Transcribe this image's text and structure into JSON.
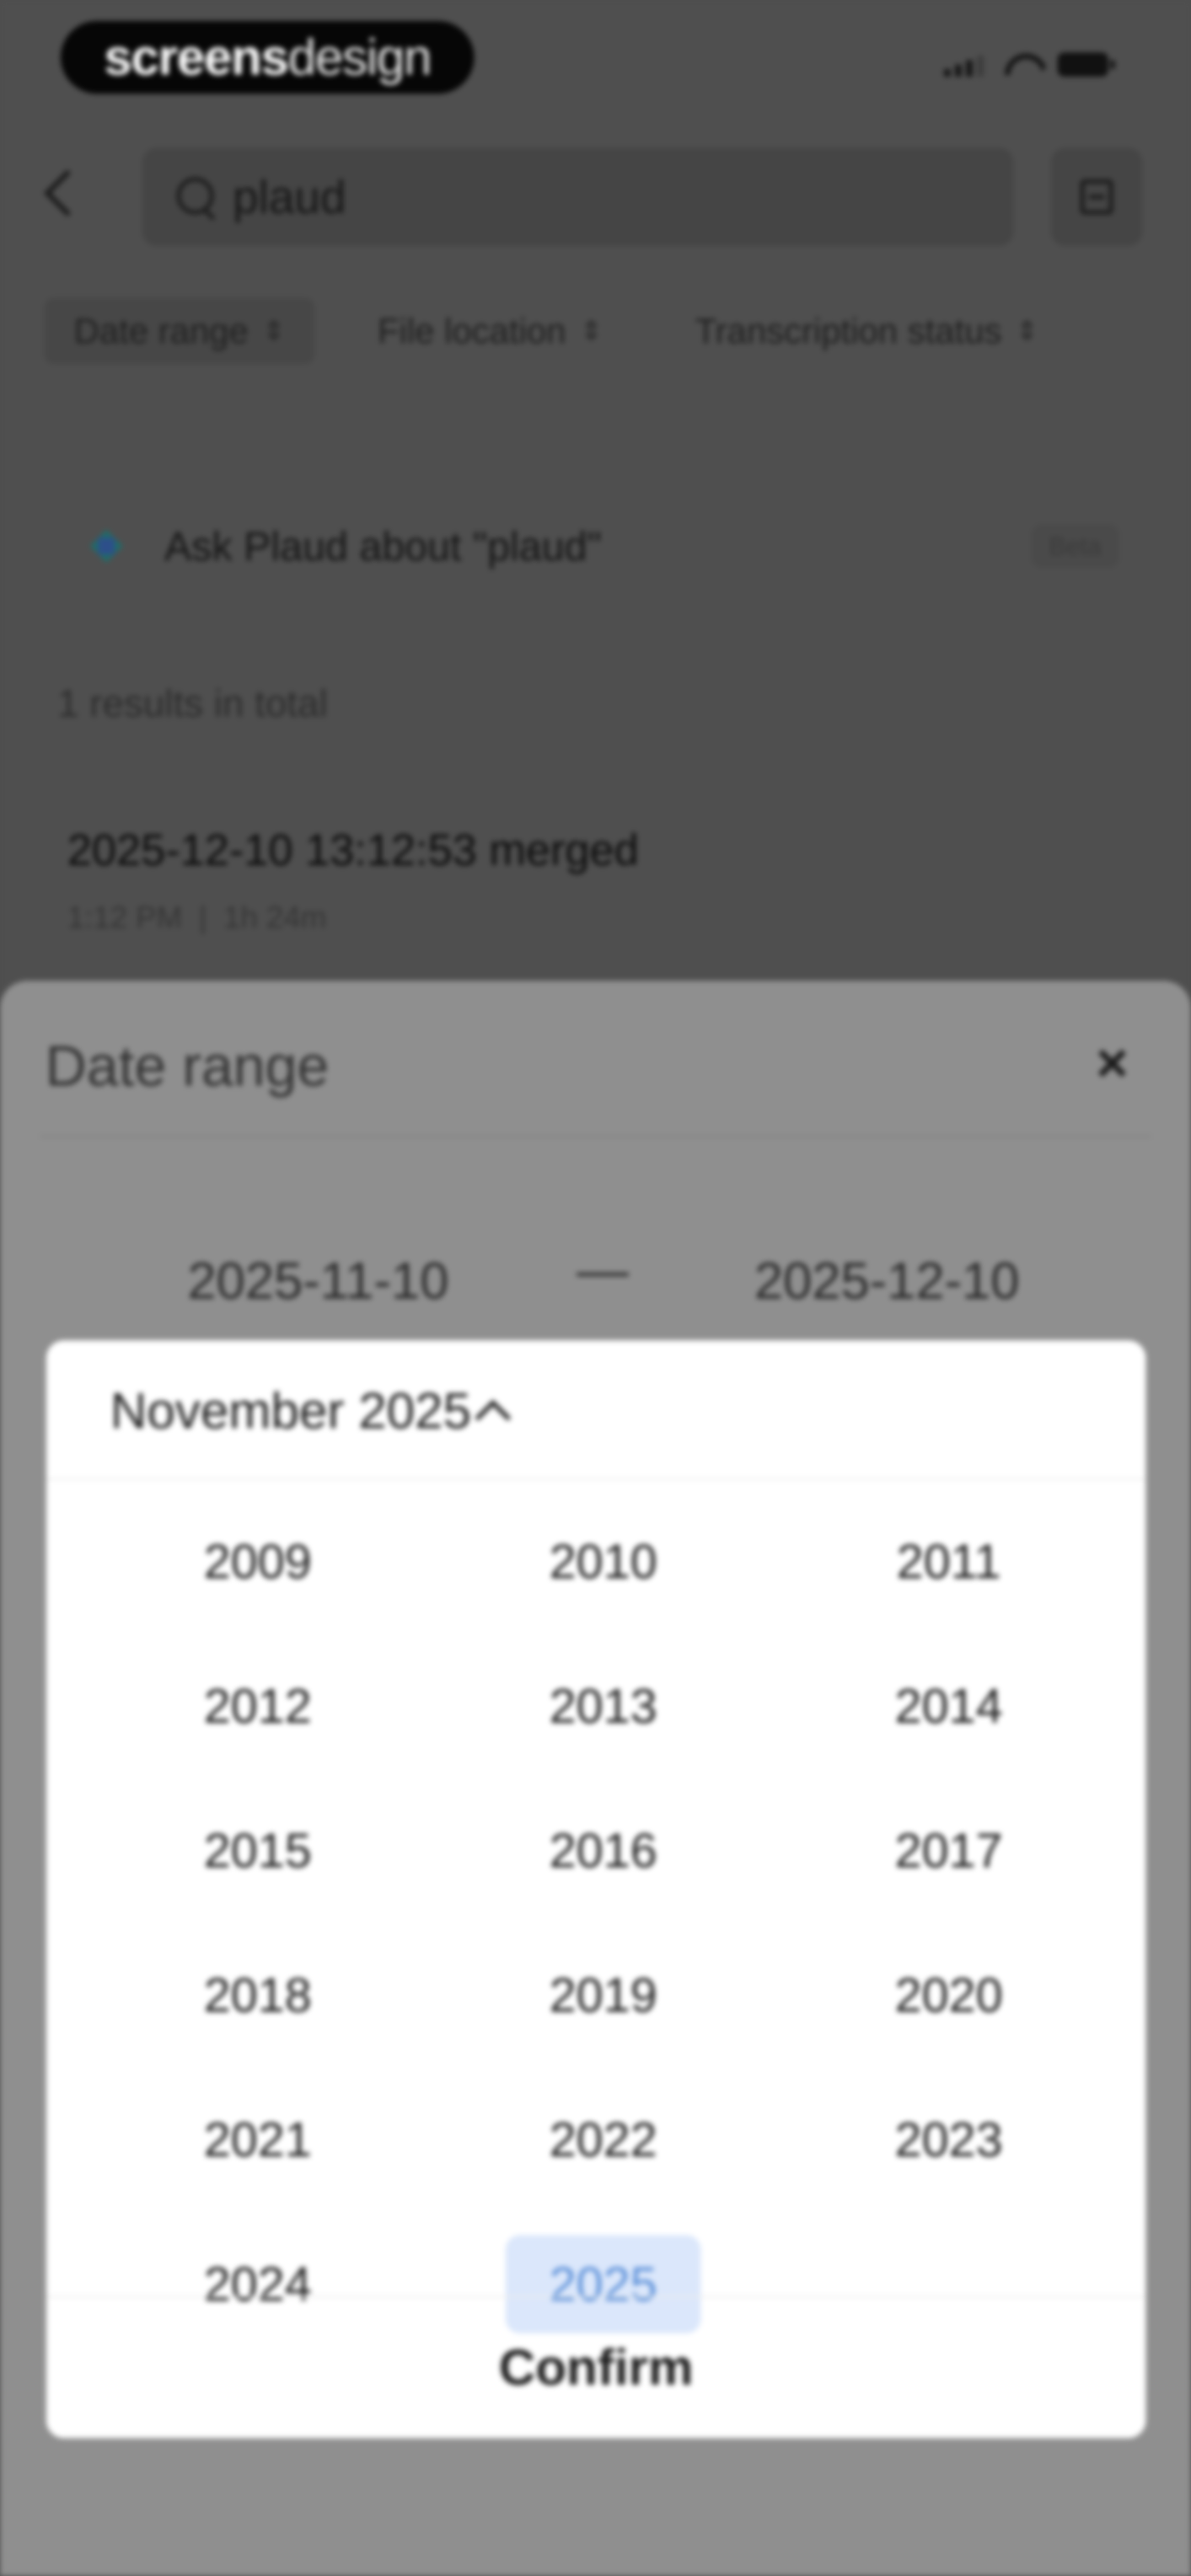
{
  "brand": {
    "bold": "screens",
    "light": "design"
  },
  "search": {
    "query": "plaud"
  },
  "filters": [
    {
      "label": "Date range",
      "active": true
    },
    {
      "label": "File location",
      "active": false
    },
    {
      "label": "Transcription status",
      "active": false
    }
  ],
  "ask": {
    "label": "Ask Plaud about \"plaud\"",
    "badge": "Beta"
  },
  "results": {
    "count_label": "1 results in total",
    "items": [
      {
        "title": "2025-12-10 13:12:53 merged",
        "time": "1:12 PM",
        "duration": "1h 24m"
      }
    ]
  },
  "sheet": {
    "title": "Date range",
    "close": "×",
    "from": "2025-11-10",
    "separator": "—",
    "to": "2025-12-10"
  },
  "picker": {
    "month_label": "November 2025",
    "years": [
      "2009",
      "2010",
      "2011",
      "2012",
      "2013",
      "2014",
      "2015",
      "2016",
      "2017",
      "2018",
      "2019",
      "2020",
      "2021",
      "2022",
      "2023",
      "2024",
      "2025"
    ],
    "selected_year": "2025",
    "confirm": "Confirm"
  },
  "colors": {
    "overlay": "#4f4f4f",
    "sheet": "#8f8f8f",
    "picker_bg": "#ffffff",
    "selected_bg": "#dbe7fb",
    "selected_text": "#5a8fd8"
  }
}
